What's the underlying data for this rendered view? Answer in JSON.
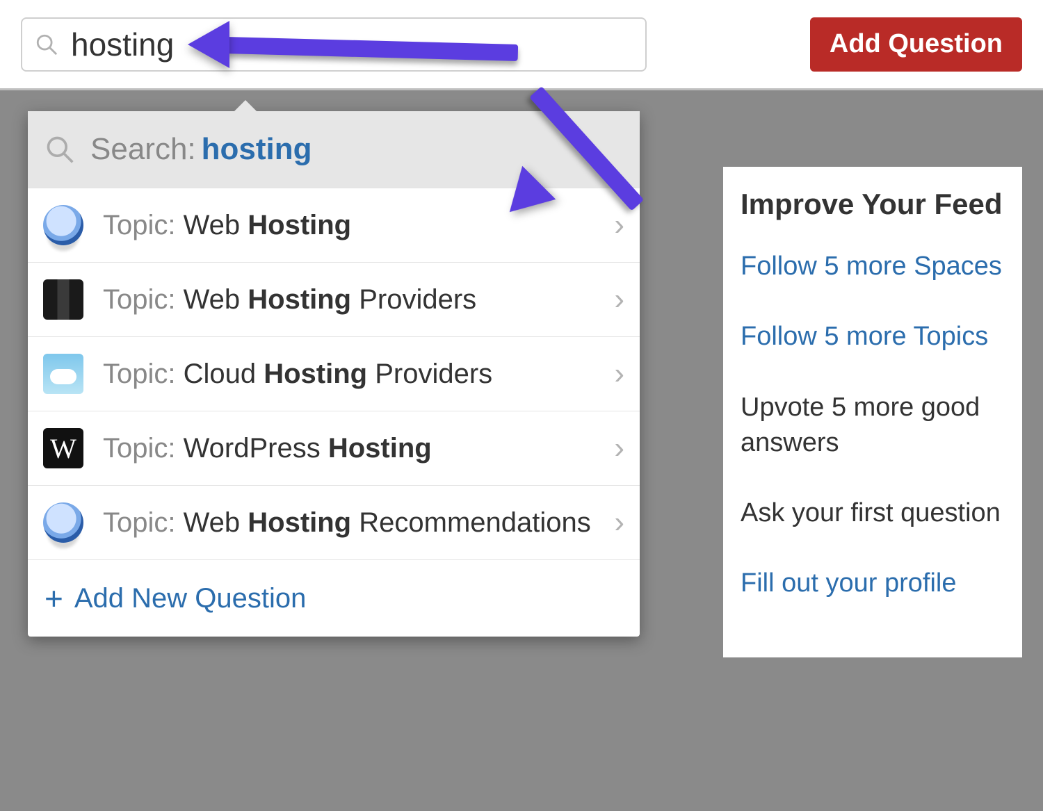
{
  "search": {
    "value": "hosting",
    "placeholder": "Search"
  },
  "add_question_label": "Add Question",
  "dropdown": {
    "search_label": "Search:",
    "search_term": "hosting",
    "items": [
      {
        "prefix": "Topic: ",
        "pre_bold": "Web ",
        "bold": "Hosting",
        "post_bold": "",
        "icon": "globe"
      },
      {
        "prefix": "Topic: ",
        "pre_bold": "Web ",
        "bold": "Hosting",
        "post_bold": " Providers",
        "icon": "servers"
      },
      {
        "prefix": "Topic: ",
        "pre_bold": "Cloud ",
        "bold": "Hosting",
        "post_bold": " Providers",
        "icon": "cloud"
      },
      {
        "prefix": "Topic: ",
        "pre_bold": "WordPress ",
        "bold": "Hosting",
        "post_bold": "",
        "icon": "wp"
      },
      {
        "prefix": "Topic: ",
        "pre_bold": "Web ",
        "bold": "Hosting",
        "post_bold": " Recommendations",
        "icon": "globe"
      }
    ],
    "footer_label": "Add New Question"
  },
  "feed": {
    "title": "Improve Your Feed",
    "items": [
      "Follow 5 more Spaces",
      "Follow 5 more Topics",
      "Upvote 5 more good answers",
      "Ask your first question",
      "Fill out your profile"
    ]
  }
}
